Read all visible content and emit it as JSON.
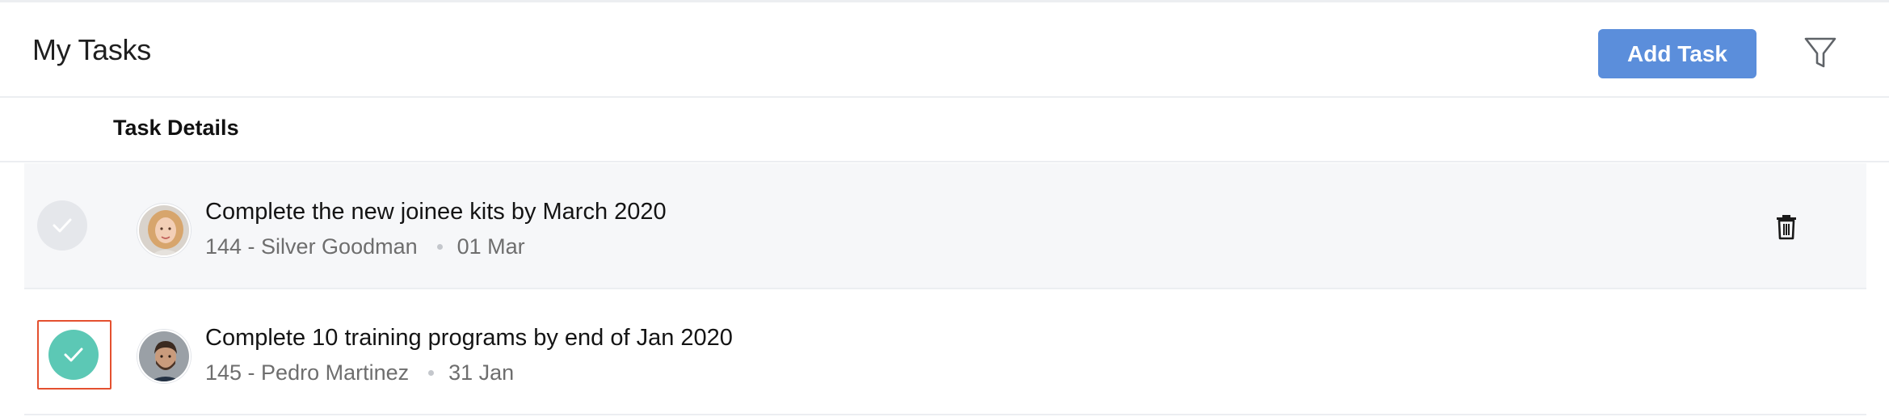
{
  "header": {
    "title": "My Tasks",
    "add_task_label": "Add Task",
    "filter_icon": "filter-icon"
  },
  "columns": {
    "task_details": "Task Details"
  },
  "tasks": [
    {
      "title": "Complete the new joinee kits by March 2020",
      "assignee": "144 - Silver Goodman",
      "date": "01 Mar",
      "completed": false,
      "avatar_icon": "avatar-woman",
      "delete_icon": "trash-icon"
    },
    {
      "title": "Complete 10 training programs by end of Jan 2020",
      "assignee": "145 - Pedro Martinez",
      "date": "31 Jan",
      "completed": true,
      "avatar_icon": "avatar-man"
    }
  ],
  "colors": {
    "accent": "#5b8edb",
    "check_done": "#5cc8b5",
    "check_pending": "#e5e7eb",
    "highlight": "#e4502f"
  }
}
